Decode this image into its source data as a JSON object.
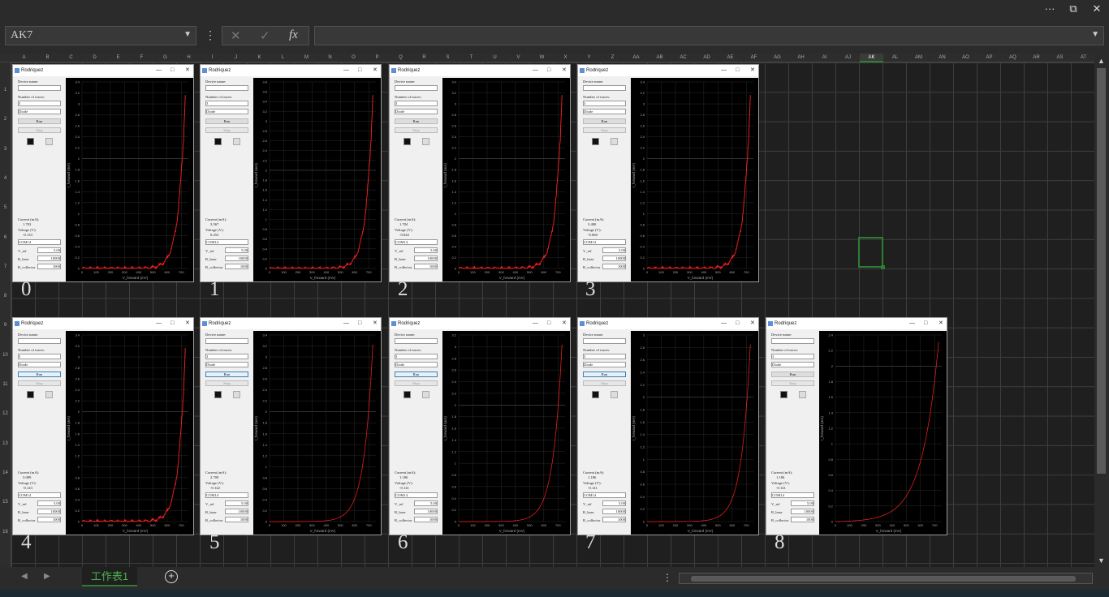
{
  "window": {
    "more_label": "···",
    "restore_label": "⧉",
    "close_label": "✕"
  },
  "formula_bar": {
    "name_box": "AK7",
    "cancel_label": "✕",
    "enter_label": "✓",
    "fx_label": "fx",
    "formula_value": ""
  },
  "columns": [
    "A",
    "B",
    "C",
    "D",
    "E",
    "F",
    "G",
    "H",
    "I",
    "J",
    "K",
    "L",
    "M",
    "N",
    "O",
    "P",
    "Q",
    "R",
    "S",
    "T",
    "U",
    "V",
    "W",
    "X",
    "Y",
    "Z",
    "AA",
    "AB",
    "AC",
    "AD",
    "AE",
    "AF",
    "AG",
    "AH",
    "AI",
    "AJ",
    "AK",
    "AL",
    "AM",
    "AN",
    "AO",
    "AP",
    "AQ",
    "AR",
    "AS",
    "AT"
  ],
  "active_column": "AK",
  "rows": [
    "1",
    "2",
    "3",
    "4",
    "5",
    "6",
    "7",
    "8",
    "9",
    "10",
    "11",
    "12",
    "13",
    "14",
    "15",
    "16"
  ],
  "sheet_tabs": [
    "工作表1"
  ],
  "app": {
    "title": "Rodriquez",
    "device_label": "Device name:",
    "traces_label": "Number of traces:",
    "traces_value": "3",
    "type_value": "Diode",
    "run_label": "Run",
    "stop_label": "Stop",
    "current_label": "Current (mA):",
    "voltage_label": "Voltage (V):",
    "port_value": "COM14",
    "vref_label": "V_ref",
    "vref_value": "5.00",
    "rbase_label": "R_base",
    "rbase_value": "10000",
    "rcoll_label": "R_collector",
    "rcoll_value": "1000",
    "x_axis_label": "V_forward (mV)",
    "y_axis_label": "I_forward (mA)"
  },
  "panels": [
    {
      "caption": "0",
      "current": "1.703",
      "voltage": "-0.133",
      "ymax": 3.4,
      "curve": "noisy"
    },
    {
      "caption": "1",
      "current": "3.567",
      "voltage": "0.253",
      "ymax": 3.8,
      "curve": "noisy"
    },
    {
      "caption": "2",
      "current": "1.704",
      "voltage": "-0.042",
      "ymax": 3.4,
      "curve": "noisy"
    },
    {
      "caption": "3",
      "current": "3.400",
      "voltage": "-0.060",
      "ymax": 3.4,
      "curve": "noisy"
    },
    {
      "caption": "4",
      "current": "3.089",
      "voltage": "-0.143",
      "ymax": 3.4,
      "curve": "noisy"
    },
    {
      "caption": "5",
      "current": "2.709",
      "voltage": "-0.142",
      "ymax": 3.4,
      "curve": "smooth"
    },
    {
      "caption": "6",
      "current": "1.186",
      "voltage": "-0.141",
      "ymax": 3.2,
      "curve": "smooth"
    },
    {
      "caption": "7",
      "current": "1.186",
      "voltage": "-0.141",
      "ymax": 3.0,
      "curve": "smooth"
    },
    {
      "caption": "8",
      "current": "1.186",
      "voltage": "-0.141",
      "ymax": 2.4,
      "curve": "gentle"
    }
  ],
  "chart_data": {
    "type": "line",
    "x_ticks": [
      0,
      100,
      200,
      300,
      400,
      500,
      600,
      700
    ],
    "xlabel": "V_forward (mV)",
    "ylabel": "I_forward (mA)",
    "xlim": [
      0,
      750
    ],
    "grid": true
  },
  "colors": {
    "trace": "#ff2020",
    "plot_bg": "#000000",
    "grid": "#2a2a2a",
    "accent": "#2e7d32"
  }
}
